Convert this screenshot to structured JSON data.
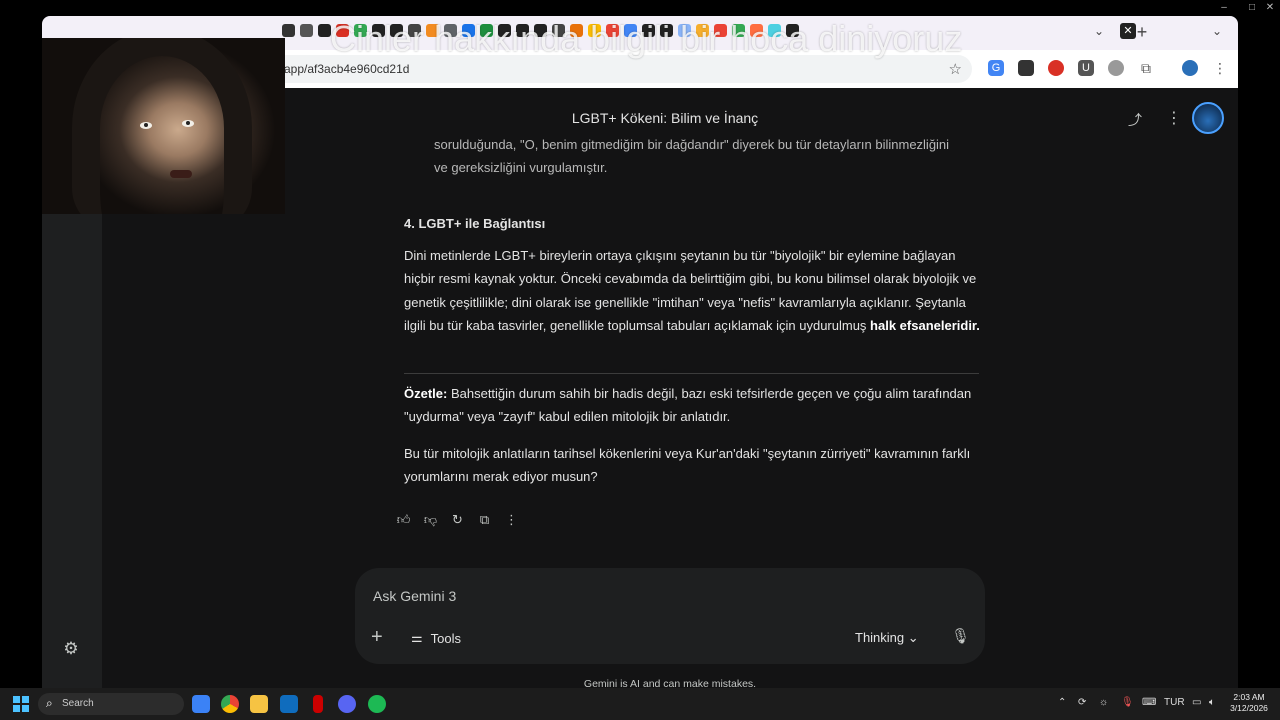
{
  "os": {
    "window_controls": [
      "–",
      "□",
      "✕"
    ]
  },
  "browser": {
    "url": "app/af3acb4e960cd21d",
    "tab_new_label": "+",
    "tab_menu_label": "⌄",
    "tab_close_label": "✕"
  },
  "overlay": {
    "caption": "Cinler hakkında bilgili bir hoca diniyoruz"
  },
  "gemini": {
    "page_title": "LGBT+ Kökeni: Bilim ve İnanç",
    "cut_line_1": "sorulduğunda, \"O, benim gitmediğim bir dağdandır\" diyerek bu tür detayların bilinmezliğini",
    "cut_line_2": "ve gereksizliğini vurgulamıştır.",
    "section_heading": "4. LGBT+ ile Bağlantısı",
    "para1_text": "Dini metinlerde LGBT+ bireylerin ortaya çıkışını şeytanın bu tür \"biyolojik\" bir eylemine bağlayan hiçbir resmi kaynak yoktur. Önceki cevabımda da belirttiğim gibi, bu konu bilimsel olarak biyolojik ve genetik çeşitlilikle; dini olarak ise genellikle \"imtihan\" veya \"nefis\" kavramlarıyla açıklanır. Şeytanla ilgili bu tür kaba tasvirler, genellikle toplumsal tabuları açıklamak için uydurulmuş ",
    "para1_bold": "halk efsaneleridir.",
    "summary_label": "Özetle:",
    "summary_text": " Bahsettiğin durum sahih bir hadis değil, bazı eski tefsirlerde geçen ve çoğu alim tarafından \"uydurma\" veya \"zayıf\" kabul edilen mitolojik bir anlatıdır.",
    "followup": "Bu tür mitolojik anlatıların tarihsel kökenlerini veya Kur'an'daki \"şeytanın zürriyeti\" kavramının farklı yorumlarını merak ediyor musun?",
    "composer_placeholder": "Ask Gemini 3",
    "tools_label": "Tools",
    "mode_label": "Thinking",
    "disclaimer": "Gemini is AI and can make mistakes."
  },
  "taskbar": {
    "search_placeholder": "Search",
    "language": "TUR",
    "time": "2:03 AM",
    "date": "3/12/2026"
  },
  "colors": {
    "background": "#131314",
    "text": "#e3e3e3",
    "accent": "#4aa0ff"
  },
  "icons": [
    "thumbs-up-icon",
    "thumbs-down-icon",
    "regenerate-icon",
    "copy-icon",
    "more-icon",
    "share-icon",
    "settings-icon",
    "mic-icon",
    "plus-icon",
    "tools-icon",
    "chevron-down-icon"
  ]
}
